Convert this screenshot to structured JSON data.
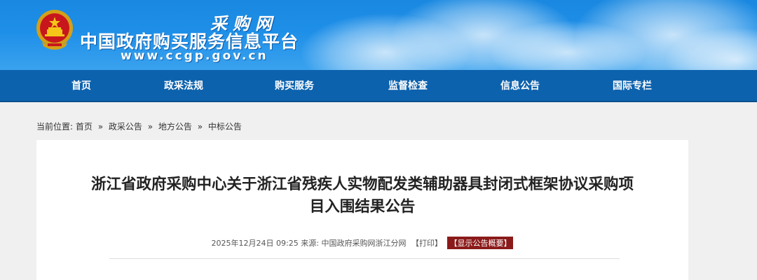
{
  "header": {
    "logo_small": "采购网",
    "logo_main": "中国政府购买服务信息平台",
    "logo_url": "www.ccgp.gov.cn"
  },
  "nav": {
    "items": [
      {
        "label": "首页"
      },
      {
        "label": "政采法规"
      },
      {
        "label": "购买服务"
      },
      {
        "label": "监督检查"
      },
      {
        "label": "信息公告"
      },
      {
        "label": "国际专栏"
      }
    ]
  },
  "breadcrumb": {
    "prefix": "当前位置:",
    "items": [
      "首页",
      "政采公告",
      "地方公告",
      "中标公告"
    ],
    "separator": "»"
  },
  "article": {
    "title_line1": "浙江省政府采购中心关于浙江省残疾人实物配发类辅助器具封闭式框架协议采购项",
    "title_line2": "目入围结果公告",
    "date": "2025年12月24日 09:25",
    "source_label": "来源:",
    "source": "中国政府采购网浙江分网",
    "print_label": "【打印】",
    "summary_label": "【显示公告概要】"
  },
  "colors": {
    "banner": "#1e8fe8",
    "nav": "#0d62ad",
    "summary_button": "#8b1a1a",
    "page_background": "#f0f0f0"
  }
}
